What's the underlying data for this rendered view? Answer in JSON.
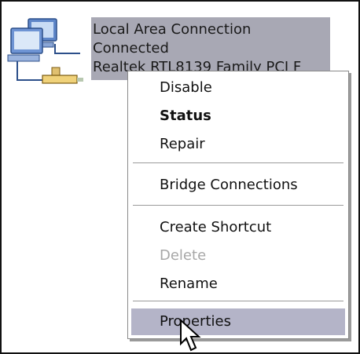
{
  "connection": {
    "name": "Local Area Connection",
    "status": "Connected",
    "device": "Realtek RTL8139 Family PCI F"
  },
  "context_menu": {
    "items": [
      {
        "label": "Disable",
        "enabled": true,
        "bold": false
      },
      {
        "label": "Status",
        "enabled": true,
        "bold": true
      },
      {
        "label": "Repair",
        "enabled": true,
        "bold": false
      },
      {
        "label": "Bridge Connections",
        "enabled": true,
        "bold": false
      },
      {
        "label": "Create Shortcut",
        "enabled": true,
        "bold": false
      },
      {
        "label": "Delete",
        "enabled": false,
        "bold": false
      },
      {
        "label": "Rename",
        "enabled": true,
        "bold": false
      },
      {
        "label": "Properties",
        "enabled": true,
        "bold": false,
        "highlighted": true
      }
    ]
  },
  "colors": {
    "selection": "#a8a8b4",
    "menu_hover": "#b4b4c8",
    "disabled_text": "#a7a7a7"
  },
  "icons": {
    "connection": "network-computers-icon",
    "pointer": "mouse-pointer-icon"
  }
}
